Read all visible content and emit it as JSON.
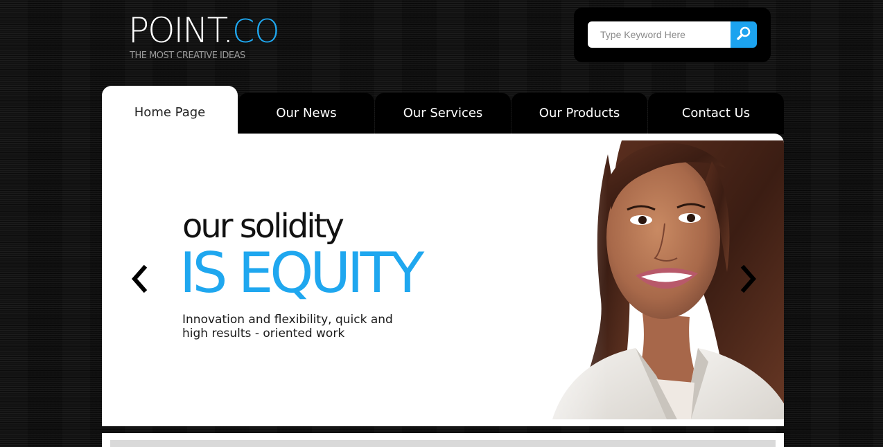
{
  "brand": {
    "name_main": "POINT",
    "name_dot": ".",
    "name_accent": "CO",
    "tagline": "THE MOST CREATIVE IDEAS"
  },
  "search": {
    "placeholder": "Type Keyword Here",
    "value": "",
    "button_icon": "search-icon"
  },
  "nav": {
    "tabs": [
      {
        "label": "Home Page",
        "active": true
      },
      {
        "label": "Our News",
        "active": false
      },
      {
        "label": "Our Services",
        "active": false
      },
      {
        "label": "Our Products",
        "active": false
      },
      {
        "label": "Contact Us",
        "active": false
      }
    ]
  },
  "slider": {
    "heading_small": "our solidity",
    "heading_big": "IS EQUITY",
    "description": "Innovation and flexibility, quick and high results - oriented work",
    "prev_icon": "chevron-left-icon",
    "next_icon": "chevron-right-icon"
  },
  "colors": {
    "accent": "#1fa7ef",
    "background": "#0e0e0e",
    "panel": "#ffffff"
  }
}
